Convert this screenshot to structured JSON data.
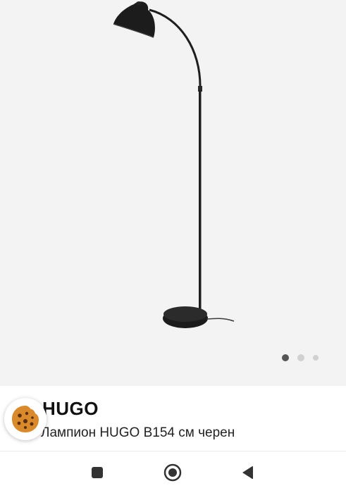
{
  "product": {
    "brand": "HUGO",
    "name": "Лампион HUGO В154 см черен"
  },
  "carousel": {
    "total": 3,
    "active_index": 0
  },
  "icons": {
    "cookie": "cookie-icon",
    "recents": "square-icon",
    "home": "circle-home-icon",
    "back": "triangle-back-icon"
  },
  "colors": {
    "image_background": "#f3f3f3",
    "lamp": "#1e1e1e",
    "cookie": "#d98a2b",
    "nav_icons": "#333333"
  }
}
